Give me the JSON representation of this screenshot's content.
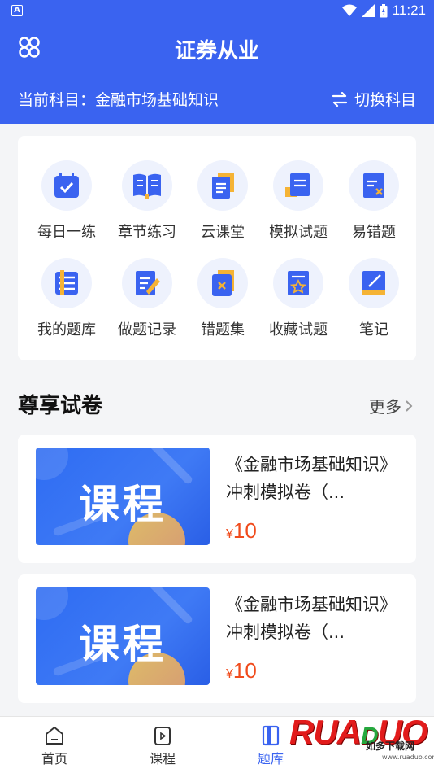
{
  "status_bar": {
    "left_glyph": "A",
    "time": "11:21"
  },
  "header": {
    "title": "证券从业",
    "subject": "当前科目：金融市场基础知识",
    "switch_label": "切换科目"
  },
  "grid": [
    {
      "label": "每日一练",
      "icon": "calendar-check-icon"
    },
    {
      "label": "章节练习",
      "icon": "open-book-icon"
    },
    {
      "label": "云课堂",
      "icon": "document-icon"
    },
    {
      "label": "模拟试题",
      "icon": "exam-paper-icon"
    },
    {
      "label": "易错题",
      "icon": "wrong-note-icon"
    },
    {
      "label": "我的题库",
      "icon": "question-bank-icon"
    },
    {
      "label": "做题记录",
      "icon": "edit-record-icon"
    },
    {
      "label": "错题集",
      "icon": "wrong-set-icon"
    },
    {
      "label": "收藏试题",
      "icon": "star-document-icon"
    },
    {
      "label": "笔记",
      "icon": "notebook-pen-icon"
    }
  ],
  "section": {
    "title": "尊享试卷",
    "more": "更多"
  },
  "courses": [
    {
      "thumb_text": "课程",
      "name": "《金融市场基础知识》冲刺模拟卷（...",
      "currency": "¥",
      "price": "10"
    },
    {
      "thumb_text": "课程",
      "name": "《金融市场基础知识》冲刺模拟卷（...",
      "currency": "¥",
      "price": "10"
    }
  ],
  "tabs": [
    {
      "label": "首页"
    },
    {
      "label": "课程"
    },
    {
      "label": "题库"
    }
  ],
  "watermark": {
    "brand": "RUANDUO",
    "slogan": "如多下载网",
    "url": "www.ruaduo.com"
  },
  "colors": {
    "primary": "#3a63f0",
    "price": "#f04b1c"
  }
}
